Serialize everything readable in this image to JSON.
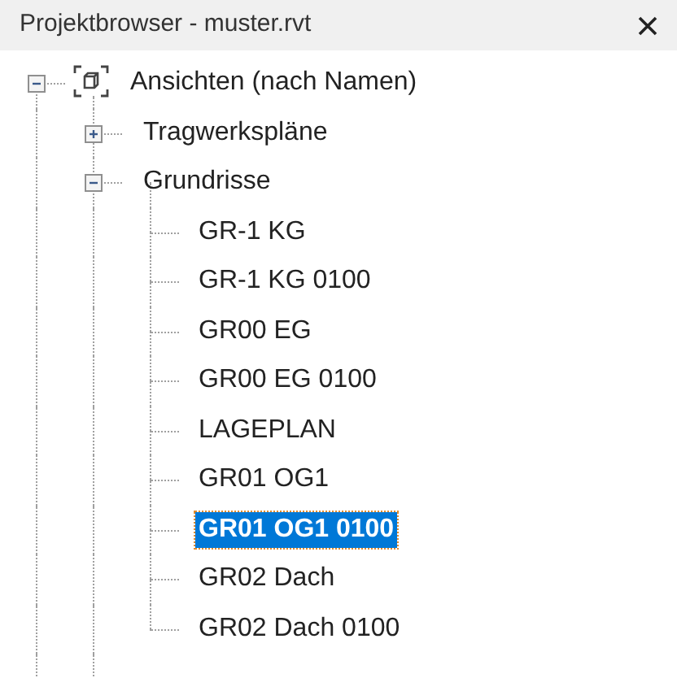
{
  "window": {
    "title": "Projektbrowser - muster.rvt"
  },
  "tree": [
    {
      "label": "Ansichten (nach Namen)",
      "expanded": true,
      "selected": false,
      "children": [
        {
          "label": "Tragwerkspläne",
          "expanded": false,
          "selected": false
        },
        {
          "label": "Grundrisse",
          "expanded": true,
          "selected": false,
          "children": [
            {
              "label": "GR-1 KG",
              "selected": false
            },
            {
              "label": "GR-1 KG 0100",
              "selected": false
            },
            {
              "label": "GR00 EG",
              "selected": false
            },
            {
              "label": "GR00 EG 0100",
              "selected": false
            },
            {
              "label": "LAGEPLAN",
              "selected": false
            },
            {
              "label": "GR01 OG1",
              "selected": false
            },
            {
              "label": "GR01 OG1 0100",
              "selected": true
            },
            {
              "label": "GR02 Dach",
              "selected": false
            },
            {
              "label": "GR02 Dach 0100",
              "selected": false
            }
          ],
          "more_siblings_below": true
        }
      ],
      "more_siblings_below": true
    }
  ]
}
